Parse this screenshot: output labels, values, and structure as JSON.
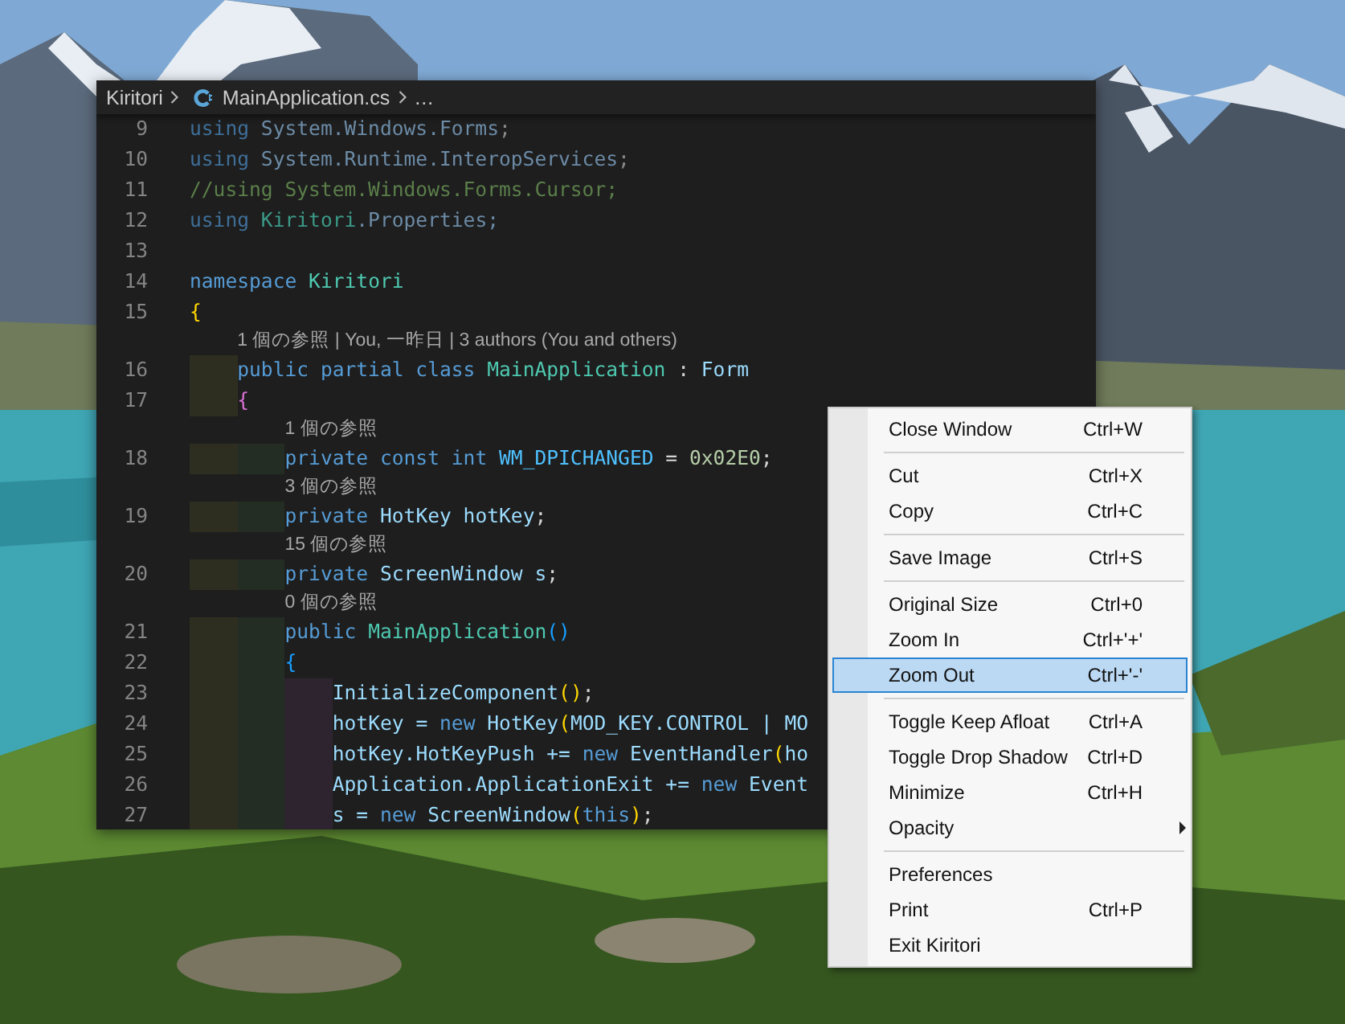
{
  "editor": {
    "breadcrumb": {
      "folder": "Kiritori",
      "file": "MainApplication.cs",
      "more": "…"
    },
    "lines": [
      {
        "kind": "code",
        "number": "9",
        "tokens": [
          {
            "text": "using ",
            "kind": "keyword_faded"
          },
          {
            "text": "System.Windows.Forms",
            "kind": "namespace_faded"
          },
          {
            "text": ";",
            "kind": "plain_faded"
          }
        ]
      },
      {
        "kind": "code",
        "number": "10",
        "tokens": [
          {
            "text": "using ",
            "kind": "keyword_faded"
          },
          {
            "text": "System.Runtime.InteropServices",
            "kind": "namespace_faded"
          },
          {
            "text": ";",
            "kind": "plain_faded"
          }
        ]
      },
      {
        "kind": "code",
        "number": "11",
        "tokens": [
          {
            "text": "//using System.Windows.Forms.Cursor;",
            "kind": "comment"
          }
        ]
      },
      {
        "kind": "code",
        "number": "12",
        "tokens": [
          {
            "text": "using ",
            "kind": "keyword_faded"
          },
          {
            "text": "Kiritori",
            "kind": "type_faded"
          },
          {
            "text": ".Properties;",
            "kind": "namespace_faded"
          }
        ]
      },
      {
        "kind": "code",
        "number": "13"
      },
      {
        "kind": "code",
        "number": "14",
        "tokens": [
          {
            "text": "namespace ",
            "kind": "keyword"
          },
          {
            "text": "Kiritori",
            "kind": "type"
          }
        ]
      },
      {
        "kind": "code",
        "number": "15",
        "tokens": [
          {
            "text": "{",
            "kind": "bracket1"
          }
        ]
      },
      {
        "kind": "lens",
        "text": "    1 個の参照 | You, 一昨日 | 3 authors (You and others)"
      },
      {
        "kind": "code",
        "number": "16",
        "tokens": [
          {
            "text": "    public partial class ",
            "kind": "keyword"
          },
          {
            "text": "MainApplication",
            "kind": "type"
          },
          {
            "text": " : ",
            "kind": "plain"
          },
          {
            "text": "Form",
            "kind": "variable"
          }
        ]
      },
      {
        "kind": "code",
        "number": "17",
        "tokens": [
          {
            "text": "    {",
            "kind": "bracket2"
          }
        ]
      },
      {
        "kind": "lens",
        "text": "        1 個の参照"
      },
      {
        "kind": "code",
        "number": "18",
        "tokens": [
          {
            "text": "        private const int ",
            "kind": "keyword"
          },
          {
            "text": "WM_DPICHANGED",
            "kind": "constant"
          },
          {
            "text": " = ",
            "kind": "plain"
          },
          {
            "text": "0x02E0",
            "kind": "number"
          },
          {
            "text": ";",
            "kind": "plain"
          }
        ]
      },
      {
        "kind": "lens",
        "text": "        3 個の参照"
      },
      {
        "kind": "code",
        "number": "19",
        "tokens": [
          {
            "text": "        private ",
            "kind": "keyword"
          },
          {
            "text": "HotKey hotKey",
            "kind": "variable"
          },
          {
            "text": ";",
            "kind": "plain"
          }
        ]
      },
      {
        "kind": "lens",
        "text": "        15 個の参照"
      },
      {
        "kind": "code",
        "number": "20",
        "tokens": [
          {
            "text": "        private ",
            "kind": "keyword"
          },
          {
            "text": "ScreenWindow s",
            "kind": "variable"
          },
          {
            "text": ";",
            "kind": "plain"
          }
        ]
      },
      {
        "kind": "lens",
        "text": "        0 個の参照"
      },
      {
        "kind": "code",
        "number": "21",
        "tokens": [
          {
            "text": "        public ",
            "kind": "keyword"
          },
          {
            "text": "MainApplication",
            "kind": "type"
          },
          {
            "text": "()",
            "kind": "bracket3"
          }
        ]
      },
      {
        "kind": "code",
        "number": "22",
        "tokens": [
          {
            "text": "        {",
            "kind": "bracket3"
          }
        ]
      },
      {
        "kind": "code",
        "number": "23",
        "tokens": [
          {
            "text": "            InitializeComponent",
            "kind": "variable"
          },
          {
            "text": "()",
            "kind": "bracket1"
          },
          {
            "text": ";",
            "kind": "plain"
          }
        ]
      },
      {
        "kind": "code",
        "number": "24",
        "tokens": [
          {
            "text": "            hotKey = ",
            "kind": "variable"
          },
          {
            "text": "new ",
            "kind": "keyword"
          },
          {
            "text": "HotKey",
            "kind": "variable"
          },
          {
            "text": "(",
            "kind": "bracket1"
          },
          {
            "text": "MOD_KEY.CONTROL | MO",
            "kind": "variable"
          }
        ]
      },
      {
        "kind": "code",
        "number": "25",
        "tokens": [
          {
            "text": "            hotKey.HotKeyPush += ",
            "kind": "variable"
          },
          {
            "text": "new ",
            "kind": "keyword"
          },
          {
            "text": "EventHandler",
            "kind": "variable"
          },
          {
            "text": "(",
            "kind": "bracket1"
          },
          {
            "text": "ho",
            "kind": "variable"
          }
        ]
      },
      {
        "kind": "code",
        "number": "26",
        "tokens": [
          {
            "text": "            Application.ApplicationExit += ",
            "kind": "variable"
          },
          {
            "text": "new ",
            "kind": "keyword"
          },
          {
            "text": "Event",
            "kind": "variable"
          }
        ]
      },
      {
        "kind": "code",
        "number": "27",
        "tokens": [
          {
            "text": "            s = ",
            "kind": "variable"
          },
          {
            "text": "new ",
            "kind": "keyword"
          },
          {
            "text": "ScreenWindow",
            "kind": "variable"
          },
          {
            "text": "(",
            "kind": "bracket1"
          },
          {
            "text": "this",
            "kind": "keyword"
          },
          {
            "text": ")",
            "kind": "bracket1"
          },
          {
            "text": ";",
            "kind": "plain"
          }
        ]
      }
    ]
  },
  "context_menu": {
    "items": [
      {
        "kind": "item",
        "label": "Close Window",
        "shortcut": "Ctrl+W",
        "selected": false
      },
      {
        "kind": "separator"
      },
      {
        "kind": "item",
        "label": "Cut",
        "shortcut": "Ctrl+X",
        "selected": false
      },
      {
        "kind": "item",
        "label": "Copy",
        "shortcut": "Ctrl+C",
        "selected": false
      },
      {
        "kind": "separator"
      },
      {
        "kind": "item",
        "label": "Save Image",
        "shortcut": "Ctrl+S",
        "selected": false
      },
      {
        "kind": "separator"
      },
      {
        "kind": "item",
        "label": "Original Size",
        "shortcut": "Ctrl+0",
        "selected": false
      },
      {
        "kind": "item",
        "label": "Zoom In",
        "shortcut": "Ctrl+'+'",
        "selected": false
      },
      {
        "kind": "item",
        "label": "Zoom Out",
        "shortcut": "Ctrl+'-'",
        "selected": true
      },
      {
        "kind": "separator"
      },
      {
        "kind": "item",
        "label": "Toggle Keep Afloat",
        "shortcut": "Ctrl+A",
        "selected": false
      },
      {
        "kind": "item",
        "label": "Toggle Drop Shadow",
        "shortcut": "Ctrl+D",
        "selected": false
      },
      {
        "kind": "item",
        "label": "Minimize",
        "shortcut": "Ctrl+H",
        "selected": false
      },
      {
        "kind": "item",
        "label": "Opacity",
        "submenu": true,
        "selected": false
      },
      {
        "kind": "separator"
      },
      {
        "kind": "item",
        "label": "Preferences",
        "selected": false
      },
      {
        "kind": "item",
        "label": "Print",
        "shortcut": "Ctrl+P",
        "selected": false
      },
      {
        "kind": "item",
        "label": "Exit Kiritori",
        "selected": false
      }
    ]
  }
}
